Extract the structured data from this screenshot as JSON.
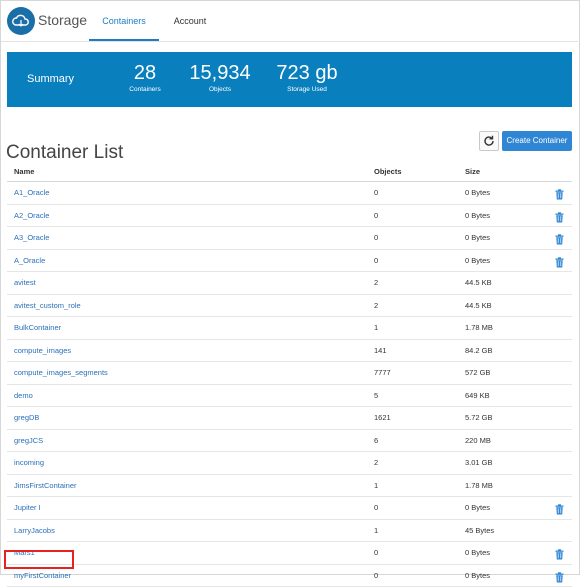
{
  "header": {
    "app_title": "Storage",
    "tabs": [
      {
        "label": "Containers",
        "active": true
      },
      {
        "label": "Account",
        "active": false
      }
    ]
  },
  "summary": {
    "label": "Summary",
    "containers_value": "28",
    "containers_label": "Containers",
    "objects_value": "15,934",
    "objects_label": "Objects",
    "storage_value": "723 gb",
    "storage_label": "Storage Used"
  },
  "container_list": {
    "title": "Container List",
    "create_label": "Create Container",
    "columns": {
      "name": "Name",
      "objects": "Objects",
      "size": "Size"
    },
    "rows": [
      {
        "name": "A1_Oracle",
        "objects": "0",
        "size": "0 Bytes",
        "deletable": true
      },
      {
        "name": "A2_Oracle",
        "objects": "0",
        "size": "0 Bytes",
        "deletable": true
      },
      {
        "name": "A3_Oracle",
        "objects": "0",
        "size": "0 Bytes",
        "deletable": true
      },
      {
        "name": "A_Oracle",
        "objects": "0",
        "size": "0 Bytes",
        "deletable": true
      },
      {
        "name": "avitest",
        "objects": "2",
        "size": "44.5 KB",
        "deletable": false
      },
      {
        "name": "avitest_custom_role",
        "objects": "2",
        "size": "44.5 KB",
        "deletable": false
      },
      {
        "name": "BulkContainer",
        "objects": "1",
        "size": "1.78 MB",
        "deletable": false
      },
      {
        "name": "compute_images",
        "objects": "141",
        "size": "84.2 GB",
        "deletable": false
      },
      {
        "name": "compute_images_segments",
        "objects": "7777",
        "size": "572 GB",
        "deletable": false
      },
      {
        "name": "demo",
        "objects": "5",
        "size": "649 KB",
        "deletable": false
      },
      {
        "name": "gregDB",
        "objects": "1621",
        "size": "5.72 GB",
        "deletable": false
      },
      {
        "name": "gregJCS",
        "objects": "6",
        "size": "220 MB",
        "deletable": false
      },
      {
        "name": "incoming",
        "objects": "2",
        "size": "3.01 GB",
        "deletable": false
      },
      {
        "name": "JimsFirstContainer",
        "objects": "1",
        "size": "1.78 MB",
        "deletable": false
      },
      {
        "name": "Jupiter I",
        "objects": "0",
        "size": "0 Bytes",
        "deletable": true
      },
      {
        "name": "LarryJacobs",
        "objects": "1",
        "size": "45 Bytes",
        "deletable": false
      },
      {
        "name": "Mars1",
        "objects": "0",
        "size": "0 Bytes",
        "deletable": true
      },
      {
        "name": "myFirstContainer",
        "objects": "0",
        "size": "0 Bytes",
        "deletable": true
      }
    ]
  },
  "colors": {
    "accent": "#0a7fbe",
    "button": "#2f86d4",
    "link": "#2a6fb8",
    "highlight": "#e52222"
  },
  "icons": {
    "logo": "cloud-storage-icon",
    "refresh": "refresh-icon",
    "delete": "trash-icon"
  }
}
